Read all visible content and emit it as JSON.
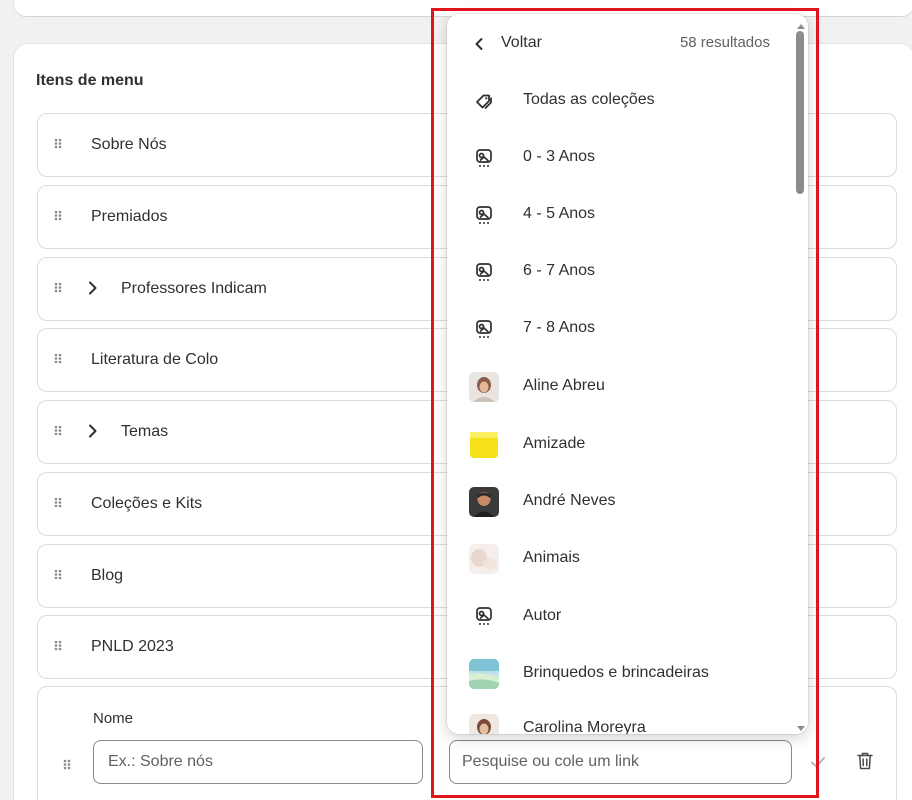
{
  "section_title": "Itens de menu",
  "menu_items": [
    {
      "label": "Sobre Nós",
      "has_children": false
    },
    {
      "label": "Premiados",
      "has_children": false
    },
    {
      "label": "Professores Indicam",
      "has_children": true
    },
    {
      "label": "Literatura de Colo",
      "has_children": false
    },
    {
      "label": "Temas",
      "has_children": true
    },
    {
      "label": "Coleções e Kits",
      "has_children": false
    },
    {
      "label": "Blog",
      "has_children": false
    },
    {
      "label": "PNLD 2023",
      "has_children": false
    }
  ],
  "edit_item": {
    "name_label": "Nome",
    "name_placeholder": "Ex.: Sobre nós",
    "link_placeholder": "Pesquise ou cole um link"
  },
  "dropdown": {
    "back_label": "Voltar",
    "results_count": "58 resultados",
    "items": [
      {
        "label": "Todas as coleções",
        "icon": "collection-tag-icon"
      },
      {
        "label": "0 - 3 Anos",
        "icon": "collection-icon"
      },
      {
        "label": "4 - 5 Anos",
        "icon": "collection-icon"
      },
      {
        "label": "6 - 7 Anos",
        "icon": "collection-icon"
      },
      {
        "label": "7 - 8 Anos",
        "icon": "collection-icon"
      },
      {
        "label": "Aline Abreu",
        "icon": "portrait-thumbnail"
      },
      {
        "label": "Amizade",
        "icon": "yellow-thumbnail"
      },
      {
        "label": "André Neves",
        "icon": "portrait-thumbnail"
      },
      {
        "label": "Animais",
        "icon": "faded-thumbnail"
      },
      {
        "label": "Autor",
        "icon": "collection-icon"
      },
      {
        "label": "Brinquedos e brincadeiras",
        "icon": "landscape-thumbnail"
      },
      {
        "label": "Carolina Moreyra",
        "icon": "portrait-thumbnail"
      }
    ]
  },
  "colors": {
    "highlight": "#e0141c",
    "text": "#303030",
    "muted": "#616161",
    "border": "#dcdcdc"
  }
}
